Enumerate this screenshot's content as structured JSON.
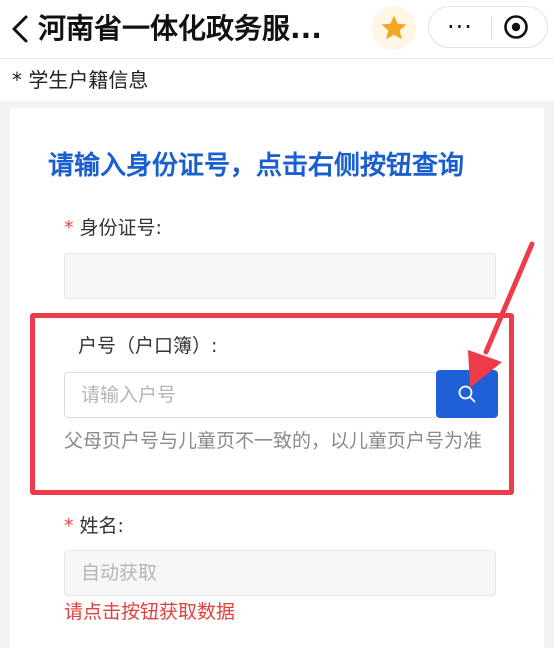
{
  "header": {
    "title": "河南省一体化政务服...",
    "more_label": "···"
  },
  "section": {
    "title": "* 学生户籍信息"
  },
  "card": {
    "heading": "请输入身份证号，点击右侧按钮查询",
    "id_field": {
      "required_mark": "*",
      "label": "身份证号:",
      "value": ""
    },
    "household_field": {
      "label": "户号（户口簿）:",
      "placeholder": "请输入户号",
      "hint": "父母页户号与儿童页不一致的，以儿童页户号为准"
    },
    "name_field": {
      "required_mark": "*",
      "label": "姓名:",
      "placeholder": "自动获取"
    },
    "error": "请点击按钮获取数据"
  },
  "colors": {
    "accent_blue": "#1f5fd8",
    "heading_blue": "#1a5fd0",
    "annotation_red": "#ee3b49",
    "star_orange": "#f5a623",
    "error_red": "#e0423b"
  },
  "icons": [
    "back-chevron-icon",
    "star-icon",
    "more-icon",
    "target-icon",
    "search-icon",
    "annotation-arrow"
  ]
}
